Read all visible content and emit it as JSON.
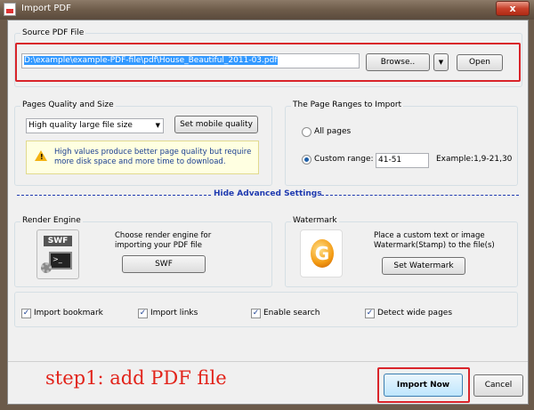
{
  "window": {
    "title": "Import PDF",
    "close_glyph": "x"
  },
  "source": {
    "legend": "Source PDF File",
    "path": "D:\\example\\example-PDF-file\\pdf\\House_Beautiful_2011-03.pdf",
    "browse_label": "Browse..",
    "dropdown_glyph": "▼",
    "open_label": "Open"
  },
  "quality": {
    "legend": "Pages Quality and Size",
    "selected": "High quality large file size",
    "mobile_label": "Set mobile quality",
    "hint": "High values produce better page quality but require more disk space and more time to download."
  },
  "ranges": {
    "legend": "The Page Ranges to Import",
    "all_label": "All pages",
    "custom_label": "Custom range:",
    "custom_value": "41-51",
    "example": "Example:1,9-21,30"
  },
  "advanced": {
    "label": "Hide Advanced Settings"
  },
  "render": {
    "legend": "Render Engine",
    "description": "Choose render engine for importing your PDF file",
    "engine_label": "SWF",
    "icon_text": "SWF"
  },
  "watermark": {
    "legend": "Watermark",
    "description": "Place a custom text or image Watermark(Stamp) to the file(s)",
    "button_label": "Set Watermark"
  },
  "options": [
    {
      "label": "Import bookmark",
      "checked": true
    },
    {
      "label": "Import links",
      "checked": true
    },
    {
      "label": "Enable search",
      "checked": true
    },
    {
      "label": "Detect wide pages",
      "checked": true
    }
  ],
  "annotation": "step1: add PDF file",
  "footer": {
    "import_label": "Import Now",
    "cancel_label": "Cancel"
  },
  "colors": {
    "highlight": "#d9242a",
    "accent": "#1f3ab0",
    "annotation": "#e2231a"
  }
}
